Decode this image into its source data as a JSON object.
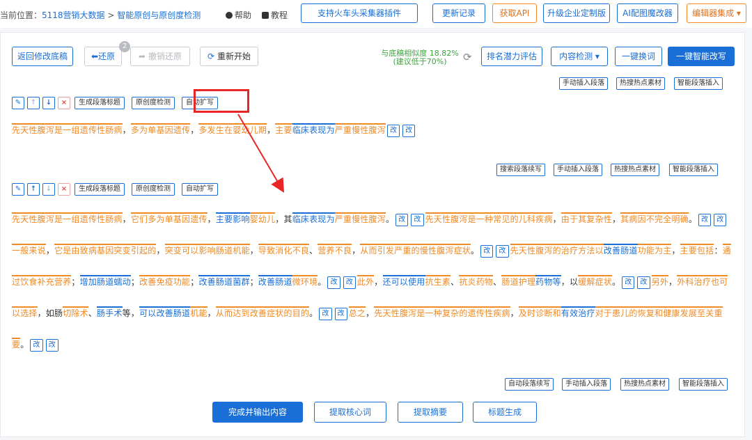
{
  "breadcrumb": {
    "prefix": "当前位置：",
    "home": "5118营销大数据",
    "sep": " > ",
    "current": "智能原创与原创度检测"
  },
  "top_links": {
    "help": "帮助",
    "tutorial": "教程"
  },
  "top_buttons": {
    "plugin": "支持火车头采集器插件",
    "changelog": "更新记录",
    "api": "获取API",
    "enterprise": "升级企业定制版",
    "ai_image": "AI配图魔改器",
    "editor": "编辑器集成"
  },
  "toolbar": {
    "back": "返回修改底稿",
    "undo": "还原",
    "undo_count": "2",
    "redo": "撤销还原",
    "restart": "重新开始",
    "similarity_line1": "与底稿相似度 18.82%",
    "similarity_line2": "(建议低于70%)",
    "rank": "排名潜力评估",
    "detect": "内容检测",
    "replace": "一键换词",
    "rewrite": "一键智能改写"
  },
  "insert_bar_1": [
    "手动插入段落",
    "热搜热点素材",
    "智能段落插入"
  ],
  "insert_bar_2": [
    "搜索段落续写",
    "手动插入段落",
    "热搜热点素材",
    "智能段落插入"
  ],
  "insert_bar_3": [
    "自动段落续写",
    "手动插入段落",
    "热搜热点素材",
    "智能段落插入"
  ],
  "para_tools": {
    "gen_title": "生成段落标题",
    "check": "原创度检测",
    "expand": "自动扩写"
  },
  "gai": "改",
  "paragraph1": [
    "先天性",
    "腹泻",
    "是",
    "一组",
    "遗传性",
    "肠病",
    "，",
    "多为",
    "单",
    "基因遗传",
    "，",
    "多发生在",
    "婴幼儿期",
    "，",
    "主要",
    "临床表现为",
    "严重",
    "慢性腹泻"
  ],
  "paragraph2": {
    "s1": [
      "先天性",
      "腹泻",
      "是",
      "一组",
      "遗传性",
      "肠病",
      "，",
      "它们",
      "多为",
      "单",
      "基因遗传",
      "，",
      "主要影响",
      "婴幼儿",
      "，其",
      "临床表现为",
      "严重",
      "慢性腹泻",
      "。"
    ],
    "s2": [
      "先天性",
      "腹泻",
      "是",
      "一种常见的",
      "儿科疾病",
      "，",
      "由于其",
      "复杂性",
      "，",
      "其",
      "病因",
      "不完全",
      "明确",
      "。"
    ],
    "s3": [
      "一般来说",
      "，",
      "它是由",
      "致病",
      "基因突变",
      "引起的",
      "，",
      "突变",
      "可以影响",
      "肠道",
      "机能",
      "，",
      "导致",
      "消化不良",
      "、",
      "营养不良",
      "，",
      "从而引发",
      "严重的",
      "慢性腹泻",
      "症状",
      "。"
    ],
    "s4": [
      "先天性",
      "腹泻的治疗",
      "方法",
      "以",
      "改善肠道",
      "功能",
      "为主",
      "，",
      "主要包括",
      "：",
      "通过",
      "饮食",
      "补充营养",
      "；",
      "增加肠道蠕动",
      "；",
      "改善",
      "免疫功能",
      "；",
      "改善肠道菌群",
      "；",
      "改善肠道",
      "微环境",
      "。"
    ],
    "s5": [
      "此外",
      "，",
      "还可以使用",
      "抗生素",
      "、",
      "抗炎药物",
      "、",
      "肠道",
      "护理",
      "药物等",
      "，以",
      "缓解症状",
      "。"
    ],
    "s6": [
      "另外",
      "，",
      "外科治疗",
      "也可以选择",
      "，如肠",
      "切除术",
      "、",
      "肠手术",
      "等，",
      "可以",
      "改善肠道",
      "机能",
      "，",
      "从而达到",
      "改善症状",
      "的目的",
      "。"
    ],
    "s7": [
      "总之",
      "，",
      "先天性",
      "腹泻",
      "是",
      "一种",
      "复杂的",
      "遗传性疾病",
      "，",
      "及时",
      "诊断和",
      "有效治疗",
      "对于",
      "患儿的",
      "恢复和",
      "健康发展",
      "至关重要",
      "。"
    ]
  },
  "bottom": {
    "finish": "完成并输出内容",
    "keywords": "提取核心词",
    "summary": "提取摘要",
    "title": "标题生成"
  },
  "colors": {
    "accent": "#1a6fd6",
    "orange": "#f08a24",
    "red": "#e82626",
    "green": "#3aa53a"
  }
}
